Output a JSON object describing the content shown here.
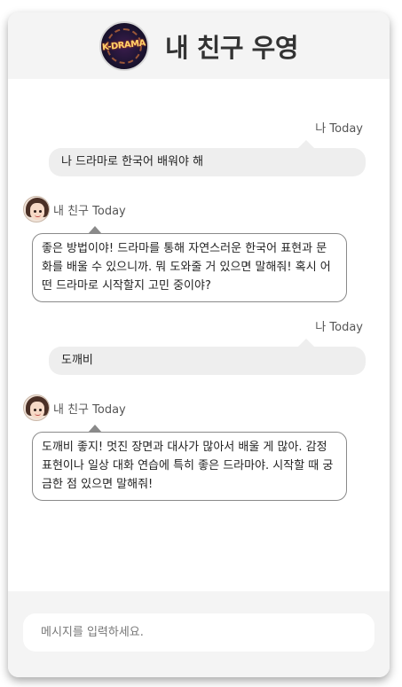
{
  "header": {
    "logo_text": "K-DRAMA",
    "title": "내 친구 우영"
  },
  "messages": [
    {
      "sender": "나",
      "meta": "나 Today",
      "text": "나 드라마로 한국어 배워야 해"
    },
    {
      "sender": "내 친구",
      "meta": "내 친구 Today",
      "text": "좋은 방법이야! 드라마를 통해 자연스러운 한국어 표현과 문화를 배울 수 있으니까. 뭐 도와줄 거 있으면 말해줘! 혹시 어떤 드라마로 시작할지 고민 중이야?"
    },
    {
      "sender": "나",
      "meta": "나 Today",
      "text": "도깨비"
    },
    {
      "sender": "내 친구",
      "meta": "내 친구 Today",
      "text": "도깨비 좋지! 멋진 장면과 대사가 많아서 배울 게 많아. 감정 표현이나 일상 대화 연습에 특히 좋은 드라마야. 시작할 때 궁금한 점 있으면 말해줘!"
    }
  ],
  "input": {
    "placeholder": "메시지를 입력하세요.",
    "value": ""
  }
}
